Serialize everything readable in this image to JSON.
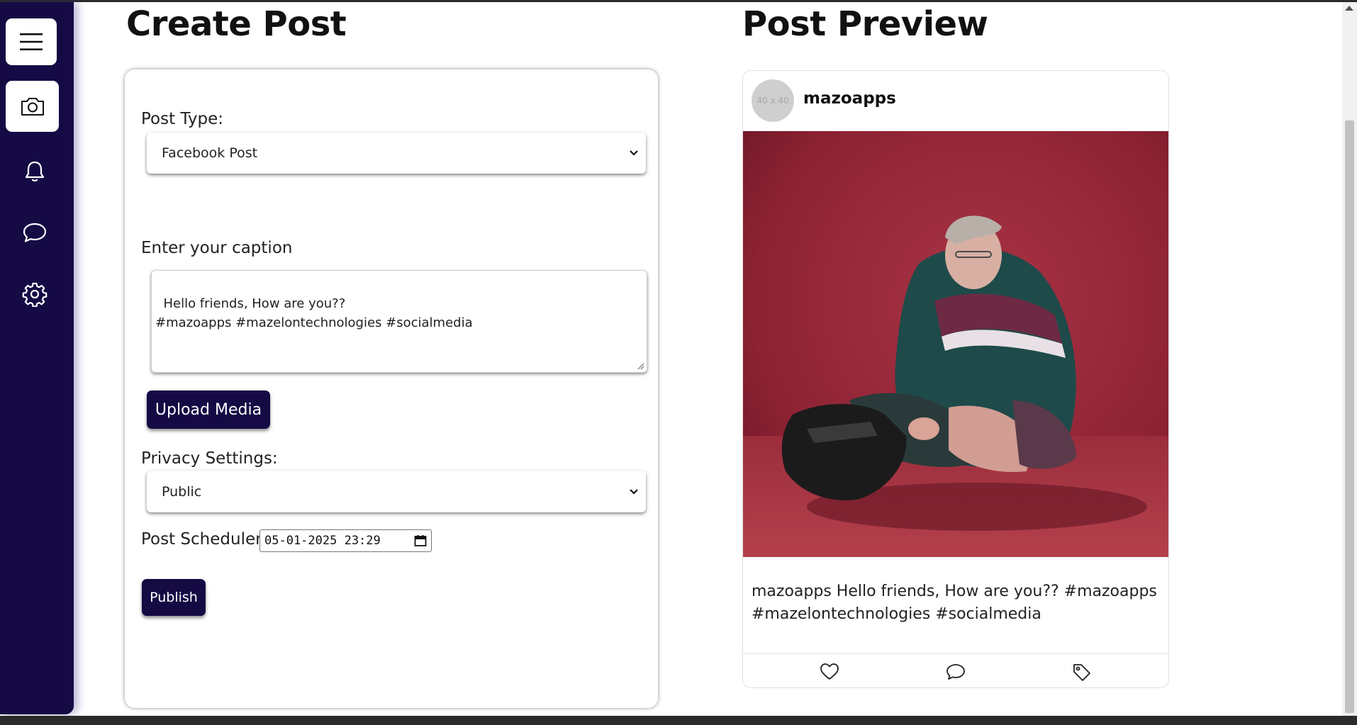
{
  "page": {
    "create_title": "Create Post",
    "preview_title": "Post Preview"
  },
  "sidebar": {
    "items": [
      {
        "name": "menu",
        "icon": "hamburger-menu-icon",
        "boxed": true
      },
      {
        "name": "camera",
        "icon": "camera-icon",
        "boxed": true
      },
      {
        "name": "notifications",
        "icon": "bell-icon",
        "boxed": false
      },
      {
        "name": "messages",
        "icon": "chat-bubble-icon",
        "boxed": false
      },
      {
        "name": "settings",
        "icon": "gear-icon",
        "boxed": false
      }
    ]
  },
  "form": {
    "post_type_label": "Post Type:",
    "post_type_value": "Facebook Post",
    "caption_label": "Enter your caption",
    "caption_value": "Hello friends, How are you??\n#mazoapps #mazelontechnologies #socialmedia",
    "upload_label": "Upload Media",
    "privacy_label": "Privacy Settings:",
    "privacy_value": "Public",
    "scheduler_label": "Post Scheduler:",
    "scheduler_value": "05-01-2025 23:29",
    "publish_label": "Publish"
  },
  "preview": {
    "avatar_placeholder": "40 x 40",
    "username": "mazoapps",
    "caption": "mazoapps Hello friends, How are you?? #mazoapps #mazelontechnologies #socialmedia",
    "actions": [
      "heart-icon",
      "comment-icon",
      "tag-icon"
    ]
  },
  "colors": {
    "sidebar": "#150a44",
    "button": "#150a44",
    "photo_background": "#9a2a38"
  }
}
